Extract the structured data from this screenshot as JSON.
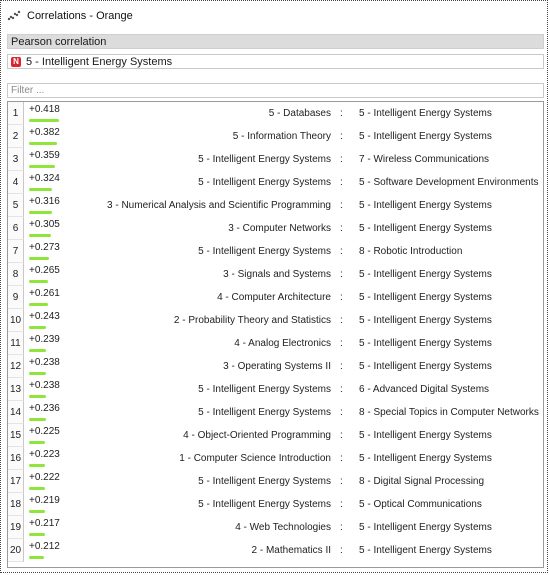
{
  "window": {
    "title": "Correlations - Orange",
    "icon": "correlations-icon"
  },
  "method": {
    "selected": "Pearson correlation"
  },
  "feature": {
    "selected": "5 - Intelligent Energy Systems",
    "badge": "N"
  },
  "filter": {
    "placeholder": "Filter ...",
    "value": ""
  },
  "colors": {
    "bar": "#8ee63a",
    "badge": "#d7262d"
  },
  "rows": [
    {
      "index": "1",
      "value": "+0.418",
      "r": 0.418,
      "feature1": "5 - Databases",
      "sep": ":",
      "feature2": "5 - Intelligent Energy Systems"
    },
    {
      "index": "2",
      "value": "+0.382",
      "r": 0.382,
      "feature1": "5 - Information Theory",
      "sep": ":",
      "feature2": "5 - Intelligent Energy Systems"
    },
    {
      "index": "3",
      "value": "+0.359",
      "r": 0.359,
      "feature1": "5 - Intelligent Energy Systems",
      "sep": ":",
      "feature2": "7 - Wireless Communications"
    },
    {
      "index": "4",
      "value": "+0.324",
      "r": 0.324,
      "feature1": "5 - Intelligent Energy Systems",
      "sep": ":",
      "feature2": "5 - Software Development Environments"
    },
    {
      "index": "5",
      "value": "+0.316",
      "r": 0.316,
      "feature1": "3 - Numerical Analysis and Scientific Programming",
      "sep": ":",
      "feature2": "5 - Intelligent Energy Systems"
    },
    {
      "index": "6",
      "value": "+0.305",
      "r": 0.305,
      "feature1": "3 - Computer Networks",
      "sep": ":",
      "feature2": "5 - Intelligent Energy Systems"
    },
    {
      "index": "7",
      "value": "+0.273",
      "r": 0.273,
      "feature1": "5 - Intelligent Energy Systems",
      "sep": ":",
      "feature2": "8 - Robotic Introduction"
    },
    {
      "index": "8",
      "value": "+0.265",
      "r": 0.265,
      "feature1": "3 - Signals and Systems",
      "sep": ":",
      "feature2": "5 - Intelligent Energy Systems"
    },
    {
      "index": "9",
      "value": "+0.261",
      "r": 0.261,
      "feature1": "4 - Computer Architecture",
      "sep": ":",
      "feature2": "5 - Intelligent Energy Systems"
    },
    {
      "index": "10",
      "value": "+0.243",
      "r": 0.243,
      "feature1": "2 - Probability Theory and Statistics",
      "sep": ":",
      "feature2": "5 - Intelligent Energy Systems"
    },
    {
      "index": "11",
      "value": "+0.239",
      "r": 0.239,
      "feature1": "4 - Analog Electronics",
      "sep": ":",
      "feature2": "5 - Intelligent Energy Systems"
    },
    {
      "index": "12",
      "value": "+0.238",
      "r": 0.238,
      "feature1": "3 - Operating Systems II",
      "sep": ":",
      "feature2": "5 - Intelligent Energy Systems"
    },
    {
      "index": "13",
      "value": "+0.238",
      "r": 0.238,
      "feature1": "5 - Intelligent Energy Systems",
      "sep": ":",
      "feature2": "6 - Advanced Digital Systems"
    },
    {
      "index": "14",
      "value": "+0.236",
      "r": 0.236,
      "feature1": "5 - Intelligent Energy Systems",
      "sep": ":",
      "feature2": "8 - Special Topics in Computer Networks"
    },
    {
      "index": "15",
      "value": "+0.225",
      "r": 0.225,
      "feature1": "4 - Object-Oriented Programming",
      "sep": ":",
      "feature2": "5 - Intelligent Energy Systems"
    },
    {
      "index": "16",
      "value": "+0.223",
      "r": 0.223,
      "feature1": "1 - Computer Science Introduction",
      "sep": ":",
      "feature2": "5 - Intelligent Energy Systems"
    },
    {
      "index": "17",
      "value": "+0.222",
      "r": 0.222,
      "feature1": "5 - Intelligent Energy Systems",
      "sep": ":",
      "feature2": "8 - Digital Signal Processing"
    },
    {
      "index": "18",
      "value": "+0.219",
      "r": 0.219,
      "feature1": "5 - Intelligent Energy Systems",
      "sep": ":",
      "feature2": "5 - Optical Communications"
    },
    {
      "index": "19",
      "value": "+0.217",
      "r": 0.217,
      "feature1": "4 - Web Technologies",
      "sep": ":",
      "feature2": "5 - Intelligent Energy Systems"
    },
    {
      "index": "20",
      "value": "+0.212",
      "r": 0.212,
      "feature1": "2 - Mathematics II",
      "sep": ":",
      "feature2": "5 - Intelligent Energy Systems"
    }
  ]
}
